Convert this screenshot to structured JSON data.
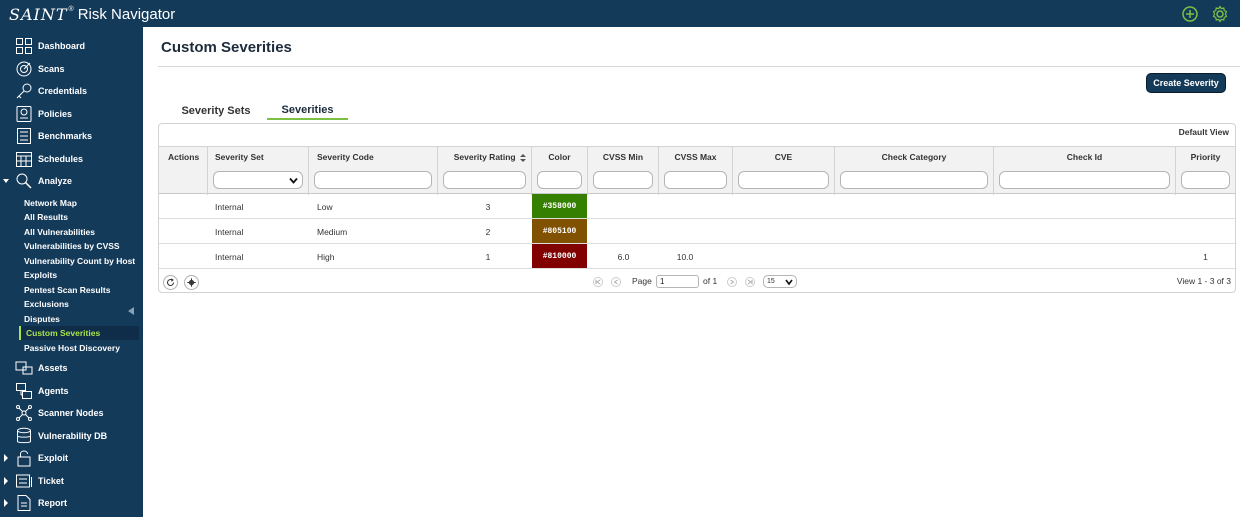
{
  "app": {
    "brand_saint": "SAINT",
    "brand_reg": "®",
    "brand_name": "Risk Navigator"
  },
  "topbar_icons": [
    "add-circle-icon",
    "gear-icon"
  ],
  "colors": {
    "nav_bg": "#143a5a",
    "accent": "#7bc143",
    "active_text": "#a6e44e"
  },
  "sidebar": {
    "items": [
      {
        "label": "Dashboard",
        "icon": "dashboard-icon"
      },
      {
        "label": "Scans",
        "icon": "scans-icon"
      },
      {
        "label": "Credentials",
        "icon": "key-icon"
      },
      {
        "label": "Policies",
        "icon": "policy-icon"
      },
      {
        "label": "Benchmarks",
        "icon": "benchmark-icon"
      },
      {
        "label": "Schedules",
        "icon": "calendar-icon"
      },
      {
        "label": "Analyze",
        "icon": "analyze-icon",
        "expanded": true
      }
    ],
    "analyze_sub": [
      "Network Map",
      "All Results",
      "All Vulnerabilities",
      "Vulnerabilities by CVSS",
      "Vulnerability Count by Host",
      "Exploits",
      "Pentest Scan Results",
      "Exclusions",
      "Disputes",
      "Custom Severities",
      "Passive Host Discovery"
    ],
    "active_sub": "Custom Severities",
    "items_after": [
      {
        "label": "Assets",
        "icon": "assets-icon"
      },
      {
        "label": "Agents",
        "icon": "agents-icon"
      },
      {
        "label": "Scanner Nodes",
        "icon": "nodes-icon"
      },
      {
        "label": "Vulnerability DB",
        "icon": "database-icon"
      },
      {
        "label": "Exploit",
        "icon": "exploit-icon"
      },
      {
        "label": "Ticket",
        "icon": "ticket-icon"
      },
      {
        "label": "Report",
        "icon": "report-icon"
      }
    ]
  },
  "main": {
    "title": "Custom Severities",
    "create_button": "Create Severity",
    "tabs": [
      {
        "label": "Severity Sets",
        "active": false
      },
      {
        "label": "Severities",
        "active": true
      }
    ]
  },
  "grid": {
    "view_label": "Default View",
    "columns": [
      "Actions",
      "Severity Set",
      "Severity Code",
      "Severity Rating",
      "Color",
      "CVSS Min",
      "CVSS Max",
      "CVE",
      "Check Category",
      "Check Id",
      "Priority"
    ],
    "rows": [
      {
        "actions": "",
        "set": "Internal",
        "code": "Low",
        "rating": "3",
        "color": "#358000",
        "cvss_min": "",
        "cvss_max": "",
        "cve": "",
        "category": "",
        "check_id": "",
        "priority": ""
      },
      {
        "actions": "",
        "set": "Internal",
        "code": "Medium",
        "rating": "2",
        "color": "#805100",
        "cvss_min": "",
        "cvss_max": "",
        "cve": "",
        "category": "",
        "check_id": "",
        "priority": ""
      },
      {
        "actions": "",
        "set": "Internal",
        "code": "High",
        "rating": "1",
        "color": "#810000",
        "cvss_min": "6.0",
        "cvss_max": "10.0",
        "cve": "",
        "category": "",
        "check_id": "",
        "priority": "1"
      }
    ],
    "pager": {
      "page_label": "Page",
      "page_value": "1",
      "of_label": "of 1",
      "rows_per_page": "15",
      "view_text": "View 1 - 3 of 3"
    }
  }
}
